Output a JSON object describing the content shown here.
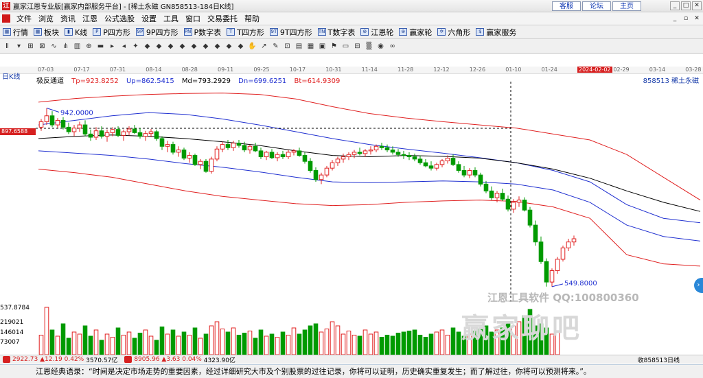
{
  "window": {
    "title": "赢家江恩专业版[赢家内部服务平台] - [稀土永磁  GN858513-184日K线]",
    "links": [
      "客服",
      "论坛",
      "主页"
    ]
  },
  "menu": [
    "文件",
    "浏览",
    "资讯",
    "江恩",
    "公式选股",
    "设置",
    "工具",
    "窗口",
    "交易委托",
    "帮助"
  ],
  "toolbar": [
    {
      "icon": "grid-icon",
      "label": "行情"
    },
    {
      "icon": "grid-icon",
      "label": "板块"
    },
    {
      "icon": "candlestick-icon",
      "label": "K线"
    },
    {
      "icon": "square-icon",
      "label": "P四方形"
    },
    {
      "icon": "square-icon",
      "label": "9P四方形"
    },
    {
      "icon": "square-icon",
      "label": "P数字表"
    },
    {
      "icon": "square-icon",
      "label": "T四方形"
    },
    {
      "icon": "square-icon",
      "label": "9T四方形"
    },
    {
      "icon": "square-icon",
      "label": "T数字表"
    },
    {
      "icon": "wheel-icon",
      "label": "江恩轮"
    },
    {
      "icon": "wheel-icon",
      "label": "赢家轮"
    },
    {
      "icon": "hexagon-icon",
      "label": "六角形"
    },
    {
      "icon": "dollar-icon",
      "label": "赢家服务"
    }
  ],
  "chart_header": {
    "period": "日K线",
    "indicator_name": "极反通道",
    "tp": "Tp=923.8252",
    "up": "Up=862.5415",
    "md": "Md=793.2929",
    "dn": "Dn=699.6251",
    "bt": "Bt=614.9309",
    "stock": "858513  稀土永磁"
  },
  "dates": [
    "07-03",
    "07-17",
    "07-31",
    "08-14",
    "08-28",
    "09-11",
    "09-25",
    "10-17",
    "10-31",
    "11-14",
    "11-28",
    "12-12",
    "12-26",
    "01-10",
    "01-24",
    "2024-02-02",
    "02-29",
    "03-14",
    "03-28"
  ],
  "highlight_date": "2024-02-02",
  "price_tag": "897.6588",
  "annotations": {
    "high": "942.0000",
    "low": "549.8000"
  },
  "volume_axis": [
    "537.8784",
    "219021",
    "146014",
    "73007"
  ],
  "watermark": {
    "line1": "江恩工具软件  QQ:100800360",
    "line2": "赢家聊吧"
  },
  "status": {
    "index1": "2922.73",
    "change1": "▲12.19 0.42%",
    "amount1": "3570.57亿",
    "index2": "8905.96",
    "change2": "▲3.63 0.04%",
    "amount2": "4323.90亿",
    "right": "收858513日线"
  },
  "quote": "江恩经典语录：“时间是决定市场走势的重要因素，经过详细研究大市及个别股票的过往记录，你将可以证明，历史确实重复发生；而了解过往，你将可以预测将来。”。",
  "colors": {
    "up": "#e02020",
    "down": "#009a00",
    "band_outer": "#e02020",
    "band_inner": "#1f2fd0",
    "mid": "#000000",
    "crosshair": "#000000"
  },
  "chart_data": {
    "type": "candlestick",
    "title": "稀土永磁 GN858513 日K线",
    "y_range": [
      515,
      1000
    ],
    "ohlc": [
      {
        "o": 900,
        "h": 918,
        "l": 892,
        "c": 912
      },
      {
        "o": 912,
        "h": 942,
        "l": 905,
        "c": 925
      },
      {
        "o": 925,
        "h": 935,
        "l": 900,
        "c": 905
      },
      {
        "o": 905,
        "h": 920,
        "l": 898,
        "c": 915
      },
      {
        "o": 915,
        "h": 922,
        "l": 895,
        "c": 900
      },
      {
        "o": 900,
        "h": 910,
        "l": 885,
        "c": 890
      },
      {
        "o": 890,
        "h": 905,
        "l": 880,
        "c": 898
      },
      {
        "o": 898,
        "h": 912,
        "l": 890,
        "c": 905
      },
      {
        "o": 905,
        "h": 915,
        "l": 880,
        "c": 885
      },
      {
        "o": 885,
        "h": 895,
        "l": 870,
        "c": 878
      },
      {
        "o": 878,
        "h": 900,
        "l": 872,
        "c": 892
      },
      {
        "o": 892,
        "h": 902,
        "l": 875,
        "c": 880
      },
      {
        "o": 880,
        "h": 895,
        "l": 868,
        "c": 888
      },
      {
        "o": 888,
        "h": 900,
        "l": 880,
        "c": 895
      },
      {
        "o": 895,
        "h": 902,
        "l": 878,
        "c": 882
      },
      {
        "o": 882,
        "h": 895,
        "l": 870,
        "c": 890
      },
      {
        "o": 890,
        "h": 902,
        "l": 882,
        "c": 896
      },
      {
        "o": 896,
        "h": 905,
        "l": 885,
        "c": 888
      },
      {
        "o": 888,
        "h": 898,
        "l": 875,
        "c": 880
      },
      {
        "o": 880,
        "h": 892,
        "l": 870,
        "c": 886
      },
      {
        "o": 886,
        "h": 896,
        "l": 878,
        "c": 890
      },
      {
        "o": 890,
        "h": 895,
        "l": 870,
        "c": 875
      },
      {
        "o": 875,
        "h": 880,
        "l": 850,
        "c": 858
      },
      {
        "o": 858,
        "h": 870,
        "l": 845,
        "c": 862
      },
      {
        "o": 862,
        "h": 868,
        "l": 840,
        "c": 845
      },
      {
        "o": 845,
        "h": 858,
        "l": 835,
        "c": 850
      },
      {
        "o": 850,
        "h": 855,
        "l": 828,
        "c": 832
      },
      {
        "o": 832,
        "h": 845,
        "l": 822,
        "c": 838
      },
      {
        "o": 838,
        "h": 842,
        "l": 815,
        "c": 818
      },
      {
        "o": 818,
        "h": 830,
        "l": 808,
        "c": 825
      },
      {
        "o": 825,
        "h": 830,
        "l": 800,
        "c": 803
      },
      {
        "o": 803,
        "h": 835,
        "l": 798,
        "c": 830
      },
      {
        "o": 830,
        "h": 858,
        "l": 825,
        "c": 852
      },
      {
        "o": 852,
        "h": 868,
        "l": 845,
        "c": 862
      },
      {
        "o": 862,
        "h": 872,
        "l": 850,
        "c": 855
      },
      {
        "o": 855,
        "h": 870,
        "l": 848,
        "c": 865
      },
      {
        "o": 865,
        "h": 872,
        "l": 855,
        "c": 860
      },
      {
        "o": 860,
        "h": 868,
        "l": 845,
        "c": 850
      },
      {
        "o": 850,
        "h": 862,
        "l": 842,
        "c": 858
      },
      {
        "o": 858,
        "h": 866,
        "l": 845,
        "c": 848
      },
      {
        "o": 848,
        "h": 855,
        "l": 830,
        "c": 835
      },
      {
        "o": 835,
        "h": 848,
        "l": 828,
        "c": 845
      },
      {
        "o": 845,
        "h": 852,
        "l": 830,
        "c": 833
      },
      {
        "o": 833,
        "h": 845,
        "l": 825,
        "c": 840
      },
      {
        "o": 840,
        "h": 848,
        "l": 830,
        "c": 835
      },
      {
        "o": 835,
        "h": 850,
        "l": 830,
        "c": 845
      },
      {
        "o": 845,
        "h": 852,
        "l": 838,
        "c": 848
      },
      {
        "o": 848,
        "h": 855,
        "l": 835,
        "c": 838
      },
      {
        "o": 838,
        "h": 845,
        "l": 820,
        "c": 825
      },
      {
        "o": 825,
        "h": 832,
        "l": 800,
        "c": 805
      },
      {
        "o": 805,
        "h": 812,
        "l": 780,
        "c": 785
      },
      {
        "o": 785,
        "h": 800,
        "l": 775,
        "c": 795
      },
      {
        "o": 795,
        "h": 815,
        "l": 790,
        "c": 810
      },
      {
        "o": 810,
        "h": 828,
        "l": 805,
        "c": 822
      },
      {
        "o": 822,
        "h": 835,
        "l": 815,
        "c": 830
      },
      {
        "o": 830,
        "h": 842,
        "l": 822,
        "c": 835
      },
      {
        "o": 835,
        "h": 845,
        "l": 828,
        "c": 840
      },
      {
        "o": 840,
        "h": 850,
        "l": 832,
        "c": 845
      },
      {
        "o": 845,
        "h": 855,
        "l": 838,
        "c": 842
      },
      {
        "o": 842,
        "h": 852,
        "l": 835,
        "c": 848
      },
      {
        "o": 848,
        "h": 858,
        "l": 840,
        "c": 850
      },
      {
        "o": 850,
        "h": 862,
        "l": 845,
        "c": 858
      },
      {
        "o": 858,
        "h": 866,
        "l": 850,
        "c": 855
      },
      {
        "o": 855,
        "h": 862,
        "l": 845,
        "c": 850
      },
      {
        "o": 850,
        "h": 858,
        "l": 840,
        "c": 845
      },
      {
        "o": 845,
        "h": 852,
        "l": 835,
        "c": 840
      },
      {
        "o": 840,
        "h": 848,
        "l": 830,
        "c": 838
      },
      {
        "o": 838,
        "h": 845,
        "l": 828,
        "c": 835
      },
      {
        "o": 835,
        "h": 842,
        "l": 825,
        "c": 830
      },
      {
        "o": 830,
        "h": 838,
        "l": 818,
        "c": 822
      },
      {
        "o": 822,
        "h": 830,
        "l": 812,
        "c": 815
      },
      {
        "o": 815,
        "h": 825,
        "l": 805,
        "c": 810
      },
      {
        "o": 810,
        "h": 822,
        "l": 805,
        "c": 818
      },
      {
        "o": 818,
        "h": 830,
        "l": 812,
        "c": 826
      },
      {
        "o": 826,
        "h": 838,
        "l": 820,
        "c": 832
      },
      {
        "o": 832,
        "h": 840,
        "l": 815,
        "c": 818
      },
      {
        "o": 818,
        "h": 825,
        "l": 800,
        "c": 805
      },
      {
        "o": 805,
        "h": 815,
        "l": 790,
        "c": 795
      },
      {
        "o": 795,
        "h": 810,
        "l": 788,
        "c": 805
      },
      {
        "o": 805,
        "h": 812,
        "l": 790,
        "c": 795
      },
      {
        "o": 795,
        "h": 800,
        "l": 770,
        "c": 775
      },
      {
        "o": 775,
        "h": 782,
        "l": 755,
        "c": 760
      },
      {
        "o": 760,
        "h": 770,
        "l": 740,
        "c": 745
      },
      {
        "o": 745,
        "h": 760,
        "l": 735,
        "c": 755
      },
      {
        "o": 755,
        "h": 765,
        "l": 738,
        "c": 742
      },
      {
        "o": 742,
        "h": 750,
        "l": 715,
        "c": 720
      },
      {
        "o": 720,
        "h": 742,
        "l": 712,
        "c": 735
      },
      {
        "o": 735,
        "h": 748,
        "l": 725,
        "c": 740
      },
      {
        "o": 740,
        "h": 746,
        "l": 715,
        "c": 718
      },
      {
        "o": 718,
        "h": 725,
        "l": 680,
        "c": 685
      },
      {
        "o": 685,
        "h": 695,
        "l": 640,
        "c": 648
      },
      {
        "o": 648,
        "h": 660,
        "l": 600,
        "c": 605
      },
      {
        "o": 605,
        "h": 612,
        "l": 550,
        "c": 560
      },
      {
        "o": 560,
        "h": 590,
        "l": 549.8,
        "c": 585
      },
      {
        "o": 585,
        "h": 615,
        "l": 578,
        "c": 610
      },
      {
        "o": 610,
        "h": 640,
        "l": 605,
        "c": 635
      },
      {
        "o": 635,
        "h": 655,
        "l": 628,
        "c": 648
      },
      {
        "o": 648,
        "h": 662,
        "l": 640,
        "c": 655
      }
    ],
    "volume": [
      95,
      230,
      120,
      90,
      150,
      80,
      110,
      100,
      140,
      90,
      120,
      70,
      100,
      85,
      130,
      95,
      110,
      80,
      105,
      120,
      90,
      70,
      135,
      100,
      120,
      90,
      110,
      95,
      130,
      80,
      100,
      140,
      160,
      125,
      110,
      130,
      95,
      105,
      115,
      80,
      120,
      90,
      100,
      85,
      110,
      95,
      130,
      100,
      120,
      140,
      150,
      110,
      125,
      160,
      140,
      100,
      115,
      95,
      90,
      120,
      100,
      110,
      85,
      95,
      90,
      105,
      110,
      115,
      120,
      95,
      85,
      100,
      110,
      120,
      95,
      130,
      110,
      90,
      100,
      115,
      125,
      140,
      110,
      120,
      130,
      150,
      140,
      160,
      190,
      220,
      140,
      150,
      130,
      100,
      115
    ],
    "bands": [
      {
        "name": "Tp",
        "values": [
          955,
          963,
          968,
          972,
          974,
          975,
          972,
          962,
          945,
          930,
          920,
          912,
          905,
          898,
          885,
          872,
          840,
          790,
          740
        ]
      },
      {
        "name": "Up",
        "values": [
          905,
          915,
          925,
          932,
          928,
          918,
          905,
          890,
          875,
          862,
          852,
          843,
          833,
          822,
          805,
          780,
          730,
          700,
          690
        ]
      },
      {
        "name": "Md",
        "values": [
          875,
          880,
          883,
          880,
          875,
          868,
          860,
          848,
          838,
          835,
          838,
          836,
          832,
          822,
          808,
          788,
          760,
          735,
          715
        ]
      },
      {
        "name": "Dn",
        "values": [
          848,
          843,
          838,
          830,
          820,
          812,
          802,
          790,
          780,
          778,
          780,
          782,
          780,
          775,
          762,
          735,
          685,
          660,
          650
        ]
      },
      {
        "name": "Bt",
        "values": [
          808,
          800,
          790,
          775,
          760,
          748,
          740,
          732,
          728,
          730,
          735,
          738,
          740,
          737,
          725,
          700,
          620,
          600,
          595
        ]
      }
    ]
  }
}
